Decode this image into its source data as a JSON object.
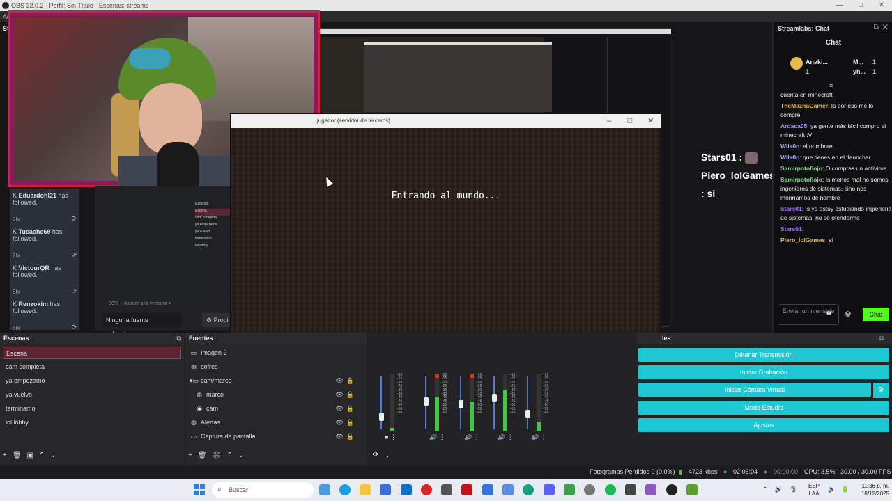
{
  "window": {
    "title": "OBS 32.0.2 - Perfil: Sin Título - Escenas: streams",
    "menu_fragment": "Arc",
    "dock_fragment": "Str"
  },
  "preview": {
    "minecraft_title": "jugador (servidor de terceros)",
    "minecraft_loading": "Entrando al mundo...",
    "overlay_chat": [
      {
        "user": "Stars01",
        "sep": " :"
      },
      {
        "user": "Piero_lolGames",
        "sep": " : si"
      }
    ],
    "follows": [
      {
        "user": "Eduardohl21",
        "text": "has followed.",
        "time": "2hr"
      },
      {
        "user": "Tucache69",
        "text": "has followed.",
        "time": "2hr"
      },
      {
        "user": "VictourQR",
        "text": "has followed.",
        "time": "5hr"
      },
      {
        "user": "Renzokim",
        "text": "has followed.",
        "time": "8hr"
      }
    ],
    "nested_scenes": [
      "Escenas",
      "Escena",
      "cam completa",
      "ya empezamo",
      "ya vuelvo",
      "terminamo",
      "lol lobby"
    ],
    "zoom": "80%",
    "fit": "Ajustar a la ventana",
    "no_source": "Ninguna fuente seleccionac",
    "properties": "Propi"
  },
  "chat": {
    "dock_title": "Streamlabs: Chat",
    "heading": "Chat",
    "viewers": [
      {
        "name": "Anaki...",
        "count": "1"
      },
      {
        "name": "M...",
        "count": "1"
      },
      {
        "name": "yh...",
        "count": "1"
      }
    ],
    "messages": [
      {
        "user": "",
        "text": "cuenta en minecraft",
        "cls": ""
      },
      {
        "user": "TheMaznaGamer",
        "text": ": Is por eso me lo compre",
        "cls": "u1"
      },
      {
        "user": "Ardaca05",
        "text": ": ya gente más fácil compro el minecraft :V",
        "cls": "u2"
      },
      {
        "user": "Wils0n",
        "text": ": el onmbnre",
        "cls": "u4"
      },
      {
        "user": "Wils0n",
        "text": ": que tienes en el tlauncher",
        "cls": "u4"
      },
      {
        "user": "Samirpotofiojo",
        "text": ": O compras un antivirus",
        "cls": "u3"
      },
      {
        "user": "Samirpotofiojo",
        "text": ": Is menos mal no somos ingenieros de sistemas, sino nos moriríamos de hambre",
        "cls": "u3"
      },
      {
        "user": "Stars01",
        "text": ": Is yo estoy estudiando ingieneria de sistemas, no sé ofenderme",
        "cls": "u5"
      },
      {
        "user": "Stars01",
        "text": ":",
        "cls": "u5"
      },
      {
        "user": "Piero_lolGames",
        "text": ": si",
        "cls": "u1"
      }
    ],
    "input_placeholder": "Enviar un mensaje",
    "send_label": "Chat"
  },
  "scenes": {
    "header": "Escenas",
    "items": [
      "Escena",
      "cam completa",
      "ya empezamo",
      "ya vuelvo",
      "terminamo",
      "lol lobby"
    ]
  },
  "sources": {
    "header": "Fuentes",
    "items": [
      {
        "name": "Imagen 2",
        "icon": "image-icon"
      },
      {
        "name": "cofres",
        "icon": "browser-icon"
      },
      {
        "name": "cam/marco",
        "icon": "folder-icon"
      },
      {
        "name": "marco",
        "icon": "browser-icon"
      },
      {
        "name": "cam",
        "icon": "camera-icon"
      },
      {
        "name": "Alertas",
        "icon": "browser-icon"
      },
      {
        "name": "Captura de pantalla",
        "icon": "monitor-icon"
      }
    ]
  },
  "mixer": {
    "scale": [
      "-10",
      "-15",
      "-20",
      "-25",
      "-30",
      "-35",
      "-40",
      "-45",
      "-50",
      "-55",
      "-60"
    ],
    "levels": [
      0.05,
      0.6,
      0.5,
      0.72,
      0.15
    ]
  },
  "controls": {
    "header_fragment": "les",
    "stop_stream": "Detener Transmisión",
    "start_record": "Iniciar Grabación",
    "start_vcam": "Iniciar Cámara Virtual",
    "studio_mode": "Modo Estudio",
    "settings": "Ajustes"
  },
  "status": {
    "dropped": "Fotogramas Perdidos 0 (0.0%)",
    "bitrate": "4723 kbps",
    "stream_time": "02:06:04",
    "rec_time": "00:00:00",
    "cpu": "CPU: 3.5%",
    "fps": "30.00 / 30.00 FPS"
  },
  "taskbar": {
    "search": "Buscar",
    "lang1": "ESP",
    "lang2": "LAA",
    "time": "11:36 p. m.",
    "date": "18/12/2025"
  }
}
